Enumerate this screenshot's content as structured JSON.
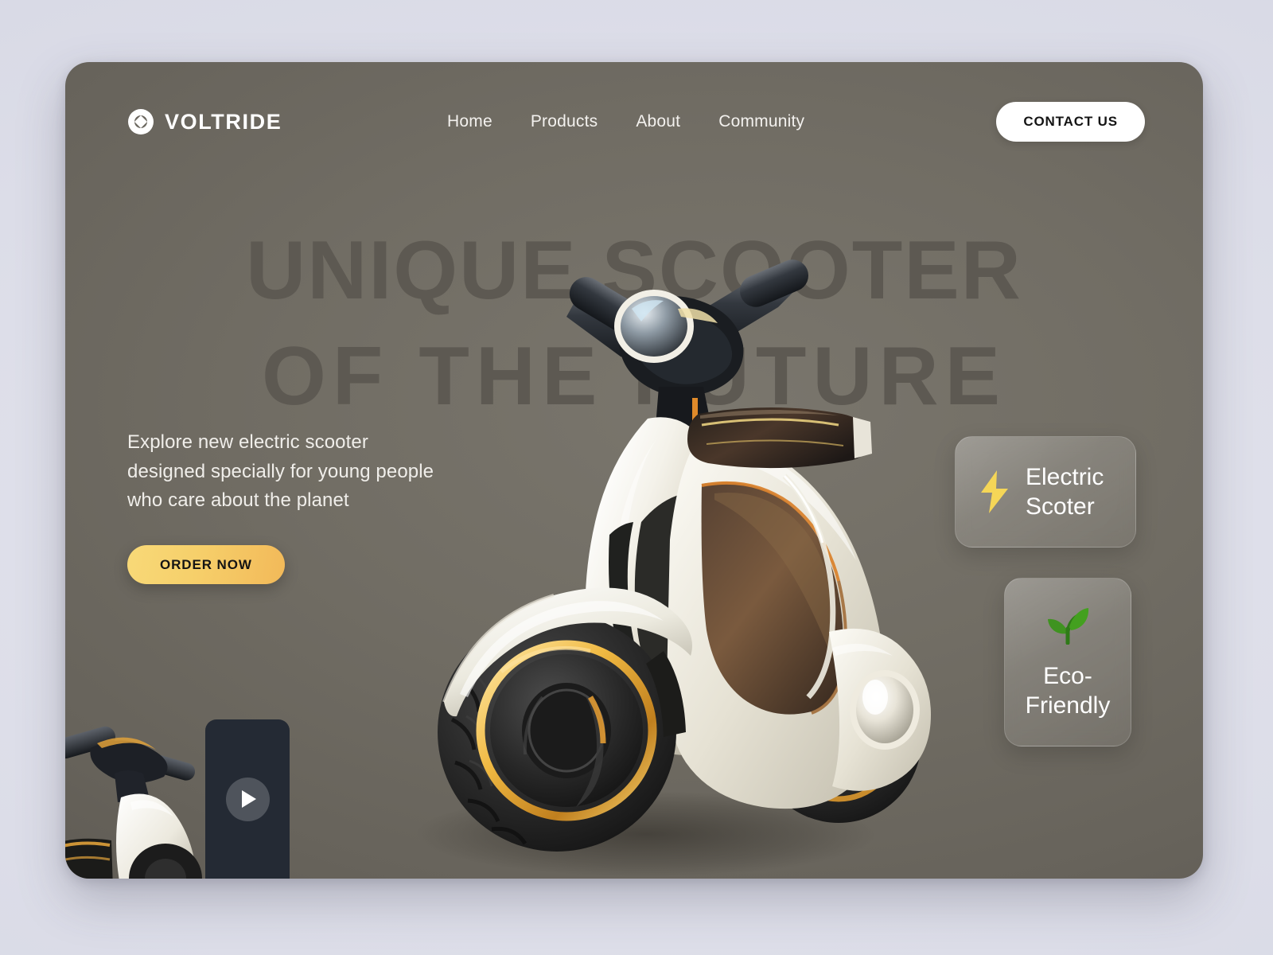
{
  "brand": {
    "name": "VOLTRIDE",
    "logo_icon": "diamond-in-circle-logo-icon"
  },
  "nav": {
    "items": [
      {
        "label": "Home"
      },
      {
        "label": "Products"
      },
      {
        "label": "About"
      },
      {
        "label": "Community"
      }
    ],
    "contact_label": "CONTACT US"
  },
  "hero": {
    "headline_line1": "UNIQUE SCOOTER",
    "headline_line2": "OF THE FUTURE",
    "subtitle": "Explore new electric scooter designed specially for young people who care about the planet",
    "order_label": "ORDER NOW"
  },
  "features": [
    {
      "title": "Electric Scoter",
      "icon": "lightning-bolt-icon",
      "icon_color": "#f5d657"
    },
    {
      "title": "Eco-Friendly",
      "icon": "leaf-sprout-icon",
      "icon_color": "#3f9320"
    }
  ],
  "video": {
    "play_icon": "play-icon"
  },
  "colors": {
    "page_background": "#dfe0ea",
    "hero_background": "#716d64",
    "headline_text": "#5d5952",
    "accent_yellow": "#f4cb62",
    "accent_gold": "#e0a33a",
    "eco_green": "#3f9320",
    "white": "#ffffff",
    "video_panel": "#242a34"
  }
}
